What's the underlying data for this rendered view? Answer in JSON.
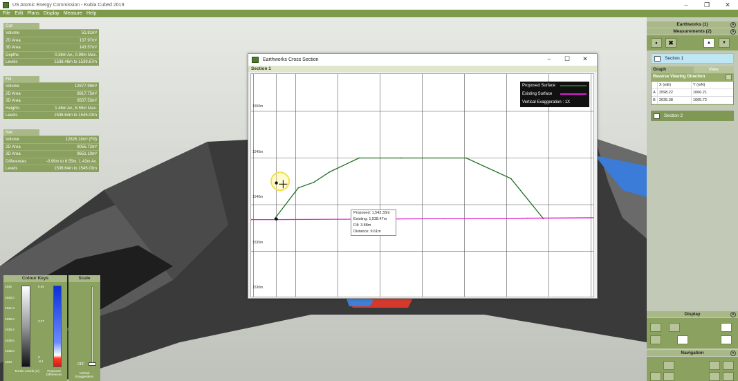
{
  "window": {
    "title": "US Atomic Energy Commission - Kubla Cubed 2019",
    "minimize": "–",
    "restore": "❐",
    "close": "✕"
  },
  "menu": [
    "File",
    "Edit",
    "Plans",
    "Display",
    "Measure",
    "Help"
  ],
  "cut": {
    "title": "Cut",
    "rows": [
      {
        "k": "Volume",
        "v": "51.81m³"
      },
      {
        "k": "2D Area",
        "v": "137.97m²"
      },
      {
        "k": "3D Area",
        "v": "143.57m²"
      },
      {
        "k": "Depths",
        "v": "0.38m Av., 0.99m Max."
      },
      {
        "k": "Levels",
        "v": "1538.48m to 1539.87m"
      }
    ]
  },
  "fill": {
    "title": "Fill",
    "rows": [
      {
        "k": "Volume",
        "v": "12877.99m³"
      },
      {
        "k": "2D Area",
        "v": "8917.75m²"
      },
      {
        "k": "3D Area",
        "v": "9507.53m²"
      },
      {
        "k": "Heights",
        "v": "1.46m Av., 6.55m Max."
      },
      {
        "k": "Levels",
        "v": "1536.64m to 1545.03m"
      }
    ]
  },
  "net": {
    "title": "Net",
    "rows": [
      {
        "k": "Volume",
        "v": "12826.18m³ (Fill)"
      },
      {
        "k": "2D Area",
        "v": "9055.72m²"
      },
      {
        "k": "3D Area",
        "v": "9651.10m²"
      },
      {
        "k": "Differences",
        "v": "-0.99m to 6.55m, 1.43m Av."
      },
      {
        "k": "Levels",
        "v": "1536.64m to 1545.03m"
      }
    ]
  },
  "colour_keys": {
    "title": "Colour Keys",
    "left_ticks": [
      "1545",
      "1543.0",
      "1541.0",
      "1539.8",
      "1538.2",
      "1536.6",
      "1535.0",
      "1533"
    ],
    "right_ticks": [
      "6.55",
      "3.27",
      "0",
      "-0.1"
    ],
    "left_label": "Terrain Levels (m)",
    "right_label": "Proposed Differences"
  },
  "scale": {
    "title": "Scale",
    "value": "OFF",
    "label": "Vertical Exaggeration"
  },
  "right_panel": {
    "earthworks_header": "Earthworks (1)",
    "measurements_header": "Measurements (2)",
    "section1": "Section 1",
    "section2": "Section 2",
    "tab_graph": "Graph",
    "tab_view": "View",
    "reverse_label": "Reverse Viewing Direction",
    "col_x": "X (mE)",
    "col_y": "Y (mN)",
    "coords": [
      {
        "icon": "A",
        "x": "2598.22",
        "y": "1066.21"
      },
      {
        "icon": "B",
        "x": "2635.38",
        "y": "1065.72"
      }
    ],
    "display_header": "Display",
    "navigation_header": "Navigation"
  },
  "xsec": {
    "title": "Earthworks Cross Section",
    "subtitle": "Section 1",
    "min": "–",
    "max": "☐",
    "close": "✕",
    "legend": {
      "proposed": "Proposed Surface",
      "existing": "Existing Surface",
      "vex": "Vertical Exaggeration : 1X"
    },
    "tooltip": {
      "proposed": "Proposed: 1,542.33m",
      "existing": "Existing: 1,538.47m",
      "fill": "Fill: 3.88m",
      "distance": "Distance: 9.61m"
    },
    "y_labels": [
      "1550m",
      "1545m",
      "1540m",
      "1535m",
      "1530m"
    ]
  },
  "chart_data": {
    "type": "line",
    "title": "",
    "xlabel": "",
    "ylabel": "",
    "ylim": [
      1530,
      1554
    ],
    "series": [
      {
        "name": "Proposed Surface",
        "color": "#1f6e23",
        "x": [
          0,
          5.6,
          9.3,
          13.0,
          20.0,
          30.0,
          45.4,
          56.0,
          63.7
        ],
        "y": [
          1538.5,
          1541.8,
          1542.4,
          1543.5,
          1545.0,
          1545.0,
          1545.0,
          1542.8,
          1538.5
        ]
      },
      {
        "name": "Existing Surface",
        "color": "#d91fd1",
        "x": [
          -5.6,
          0,
          20,
          40,
          60,
          75.9
        ],
        "y": [
          1538.4,
          1538.4,
          1538.45,
          1538.5,
          1538.55,
          1538.6
        ]
      }
    ],
    "colors": {
      "proposed": "#1f6e23",
      "existing": "#d91fd1",
      "legend_bg": "#111111"
    }
  }
}
